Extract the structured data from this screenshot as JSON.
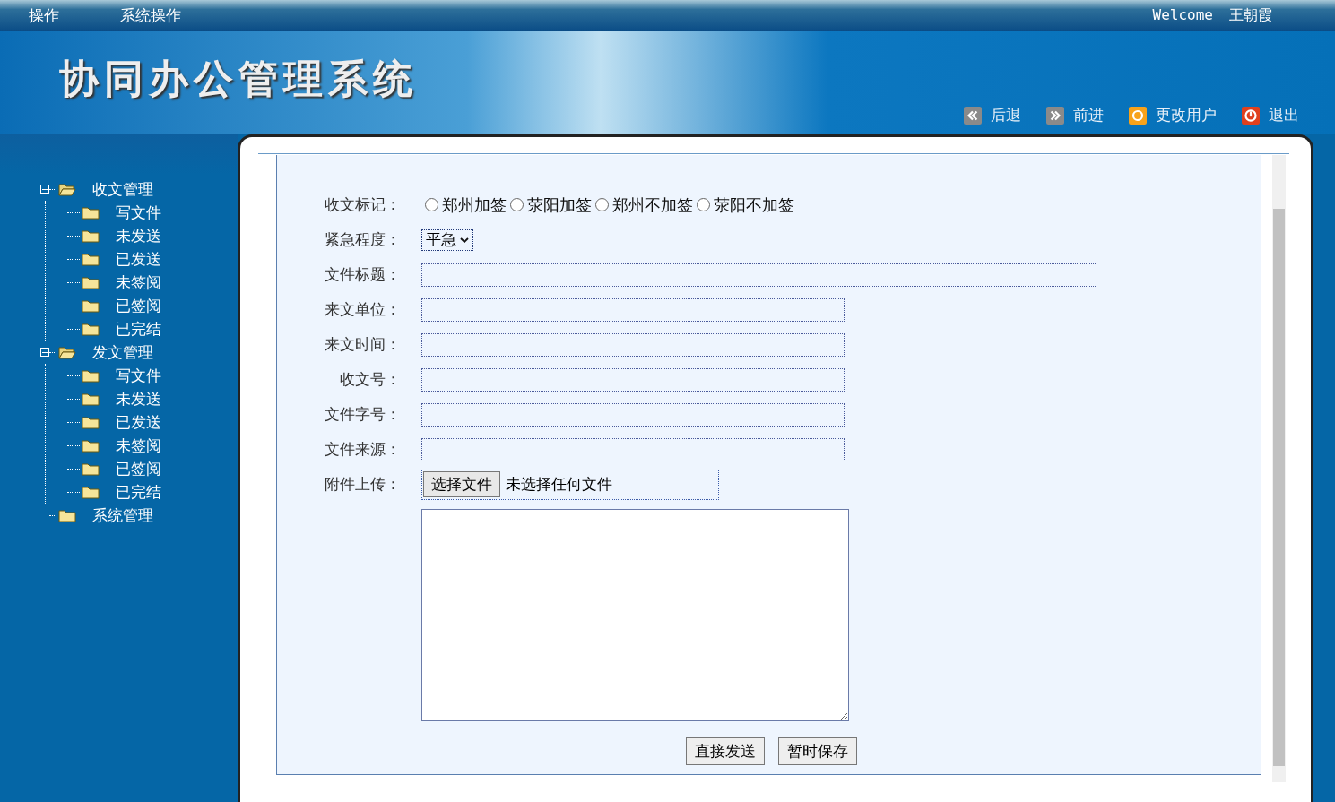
{
  "top_menu": [
    "操作",
    "系统操作"
  ],
  "welcome": {
    "label": "Welcome",
    "user": "王朝霞"
  },
  "logo": "协同办公管理系统",
  "nav_buttons": [
    {
      "kind": "back",
      "label": "后退"
    },
    {
      "kind": "forward",
      "label": "前进"
    },
    {
      "kind": "switch-user",
      "label": "更改用户"
    },
    {
      "kind": "exit",
      "label": "退出"
    }
  ],
  "tree": [
    {
      "label": "收文管理",
      "expanded": true,
      "children": [
        {
          "label": "写文件"
        },
        {
          "label": "未发送"
        },
        {
          "label": "已发送"
        },
        {
          "label": "未签阅"
        },
        {
          "label": "已签阅"
        },
        {
          "label": "已完结"
        }
      ]
    },
    {
      "label": "发文管理",
      "expanded": true,
      "children": [
        {
          "label": "写文件"
        },
        {
          "label": "未发送"
        },
        {
          "label": "已发送"
        },
        {
          "label": "未签阅"
        },
        {
          "label": "已签阅"
        },
        {
          "label": "已完结"
        }
      ]
    },
    {
      "label": "系统管理"
    }
  ],
  "form": {
    "mark": {
      "label": "收文标记：",
      "options": [
        {
          "label": "郑州加签",
          "selected": false
        },
        {
          "label": "荥阳加签",
          "selected": false
        },
        {
          "label": "郑州不加签",
          "selected": false
        },
        {
          "label": "荥阳不加签",
          "selected": false
        }
      ]
    },
    "urgency": {
      "label": "紧急程度：",
      "value": "平急"
    },
    "fields": [
      {
        "label": "文件标题：",
        "kind": "wide"
      },
      {
        "label": "来文单位：",
        "kind": "normal"
      },
      {
        "label": "来文时间：",
        "kind": "normal"
      },
      {
        "label": "收文号：",
        "kind": "normal"
      },
      {
        "label": "文件字号：",
        "kind": "normal"
      },
      {
        "label": "文件来源：",
        "kind": "normal"
      }
    ],
    "upload": {
      "label": "附件上传：",
      "button": "选择文件",
      "status": "未选择任何文件"
    },
    "buttons": [
      "直接发送",
      "暂时保存"
    ]
  }
}
